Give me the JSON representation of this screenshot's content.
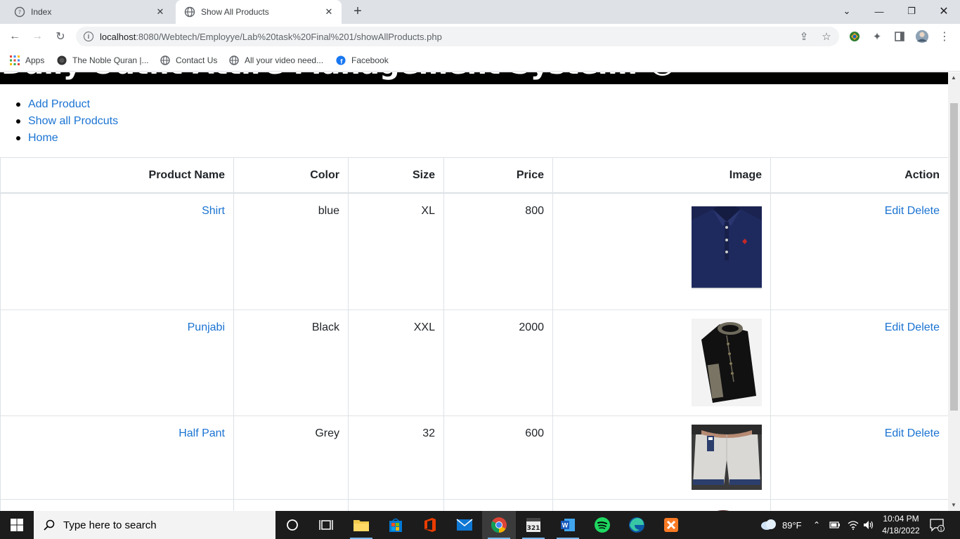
{
  "browser": {
    "tabs": [
      {
        "title": "Index",
        "active": false
      },
      {
        "title": "Show All Products",
        "active": true
      }
    ],
    "url_host": "localhost",
    "url_rest": ":8080/Webtech/Employye/Lab%20task%20Final%201/showAllProducts.php",
    "bookmarks": [
      {
        "label": "Apps",
        "icon": "apps-grid-icon"
      },
      {
        "label": "The Noble Quran |...",
        "icon": "quran-icon"
      },
      {
        "label": "Contact Us",
        "icon": "globe-icon"
      },
      {
        "label": "All your video need...",
        "icon": "globe-icon"
      },
      {
        "label": "Facebook",
        "icon": "facebook-icon"
      }
    ]
  },
  "page": {
    "banner_title": "Daily Outfit Attire Management System. 😀",
    "nav": [
      "Add Product",
      "Show all Prodcuts",
      "Home"
    ],
    "table": {
      "headers": [
        "Product Name",
        "Color",
        "Size",
        "Price",
        "Image",
        "Action"
      ],
      "rows": [
        {
          "name": "Shirt",
          "color": "blue",
          "size": "XL",
          "price": "800",
          "image": "navy-polo-shirt"
        },
        {
          "name": "Punjabi",
          "color": "Black",
          "size": "XXL",
          "price": "2000",
          "image": "black-punjabi"
        },
        {
          "name": "Half Pant",
          "color": "Grey",
          "size": "32",
          "price": "600",
          "image": "grey-shorts"
        }
      ],
      "edit_label": "Edit",
      "delete_label": "Delete"
    }
  },
  "taskbar": {
    "search_placeholder": "Type here to search",
    "weather": "89°F",
    "time": "10:04 PM",
    "date": "4/18/2022",
    "notification_count": "1"
  }
}
